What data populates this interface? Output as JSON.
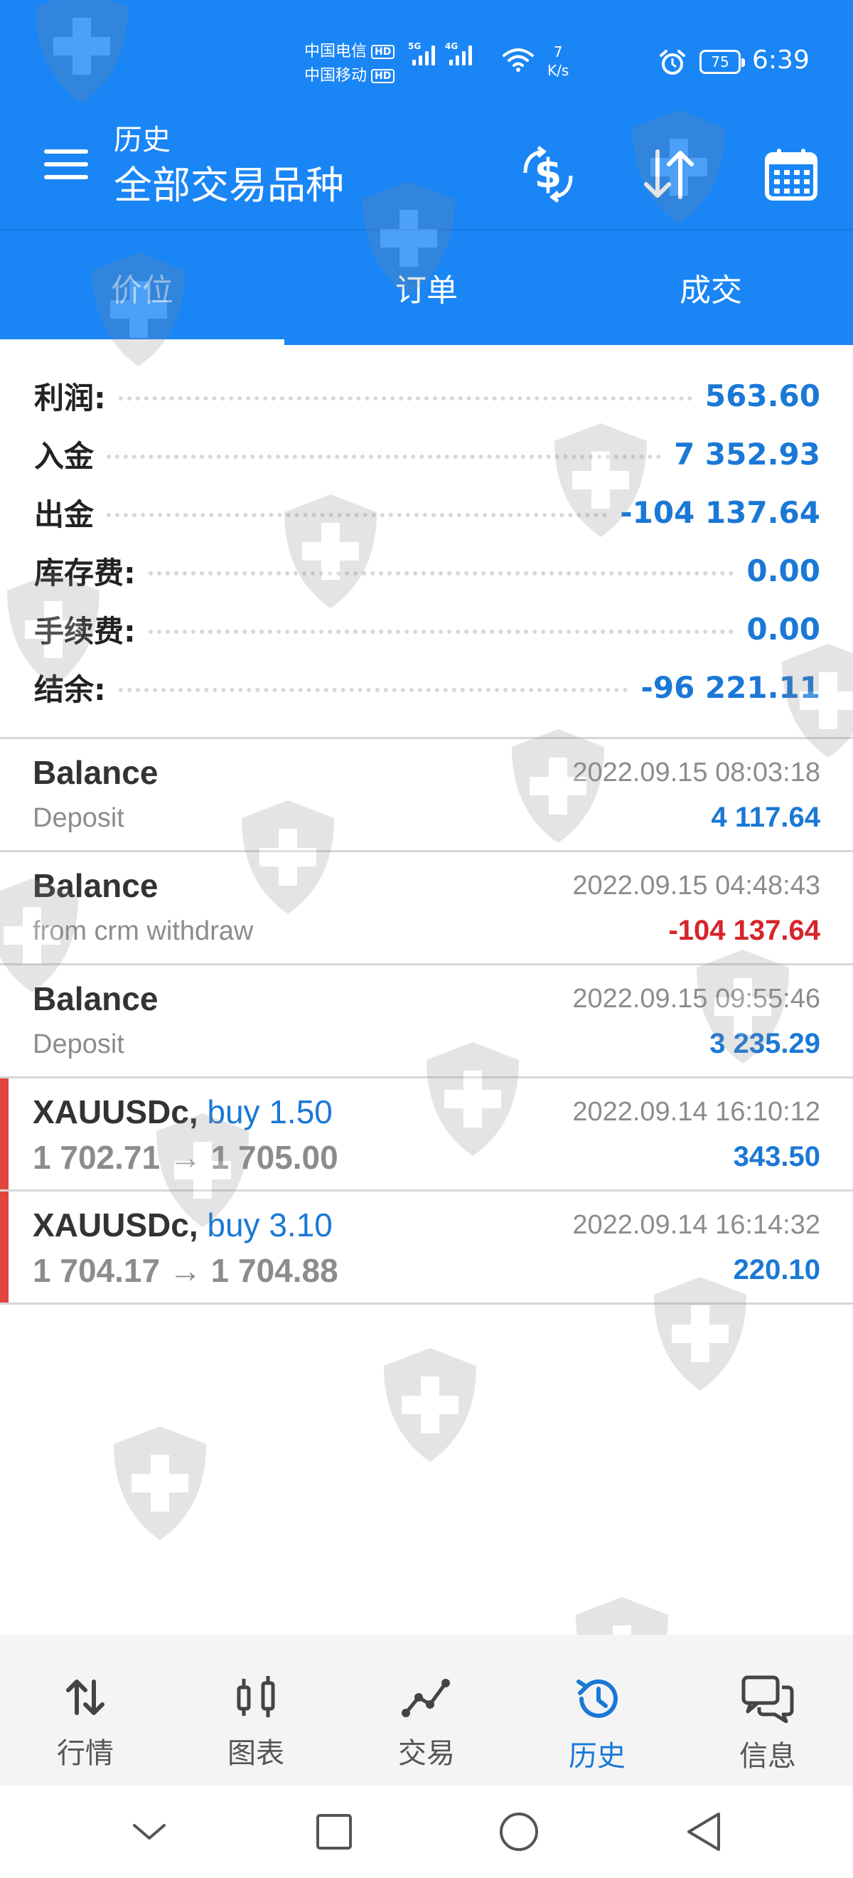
{
  "status_bar": {
    "carrier1": "中国电信",
    "carrier2": "中国移动",
    "hd_badge": "HD",
    "net1": "5G",
    "net2": "4G",
    "speed_value": "7",
    "speed_unit": "K/s",
    "battery": "75",
    "time": "6:39"
  },
  "app_bar": {
    "title_small": "历史",
    "title_big": "全部交易品种"
  },
  "tabs": [
    {
      "label": "价位"
    },
    {
      "label": "订单"
    },
    {
      "label": "成交"
    }
  ],
  "summary": [
    {
      "label": "利润:",
      "value": "563.60"
    },
    {
      "label": "入金",
      "value": "7 352.93"
    },
    {
      "label": "出金",
      "value": "-104 137.64"
    },
    {
      "label": "库存费:",
      "value": "0.00"
    },
    {
      "label": "手续费:",
      "value": "0.00"
    },
    {
      "label": "结余:",
      "value": "-96 221.11"
    }
  ],
  "history": [
    {
      "title": "Balance",
      "subtitle": "Deposit",
      "time": "2022.09.15 08:03:18",
      "amount": "4 117.64"
    },
    {
      "title": "Balance",
      "subtitle": "from crm withdraw",
      "time": "2022.09.15 04:48:43",
      "amount": "-104 137.64"
    },
    {
      "title": "Balance",
      "subtitle": "Deposit",
      "time": "2022.09.15 09:55:46",
      "amount": "3 235.29"
    },
    {
      "symbol": "XAUUSDc,",
      "side": "buy 1.50",
      "prices": "1 702.71 → 1 705.00",
      "time": "2022.09.14 16:10:12",
      "amount": "343.50"
    },
    {
      "symbol": "XAUUSDc,",
      "side": "buy 3.10",
      "prices": "1 704.17 → 1 704.88",
      "time": "2022.09.14 16:14:32",
      "amount": "220.10"
    }
  ],
  "bottom_nav": [
    {
      "label": "行情",
      "icon": "quotes-arrows-icon"
    },
    {
      "label": "图表",
      "icon": "chart-candles-icon"
    },
    {
      "label": "交易",
      "icon": "trade-line-icon"
    },
    {
      "label": "历史",
      "icon": "history-clock-icon"
    },
    {
      "label": "信息",
      "icon": "messages-icon"
    }
  ],
  "colors": {
    "header": "#1a85f5",
    "value_blue": "#1a78d6",
    "negative_red": "#d6242a",
    "trade_accent": "#e0463d"
  }
}
